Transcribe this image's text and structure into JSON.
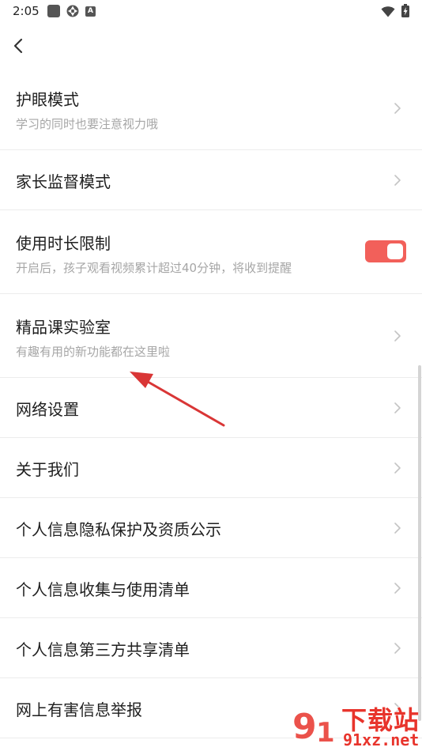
{
  "status_bar": {
    "time": "2:05",
    "icons": [
      "square-notification-icon",
      "aperture-icon",
      "a-notification-icon",
      "wifi-icon",
      "battery-icon"
    ]
  },
  "toolbar": {
    "back_icon": "chevron-left-icon"
  },
  "settings": {
    "eye_protection": {
      "title": "护眼模式",
      "subtitle": "学习的同时也要注意视力哦"
    },
    "parental_mode": {
      "title": "家长监督模式"
    },
    "time_limit": {
      "title": "使用时长限制",
      "subtitle": "开启后，孩子观看视频累计超过40分钟，将收到提醒",
      "enabled": true
    },
    "lab": {
      "title": "精品课实验室",
      "subtitle": "有趣有用的新功能都在这里啦"
    },
    "network": {
      "title": "网络设置"
    },
    "about": {
      "title": "关于我们"
    },
    "privacy": {
      "title": "个人信息隐私保护及资质公示"
    },
    "collection_list": {
      "title": "个人信息收集与使用清单"
    },
    "third_party": {
      "title": "个人信息第三方共享清单"
    },
    "report": {
      "title": "网上有害信息举报"
    }
  },
  "colors": {
    "accent": "#f2605a",
    "annotation": "#d93636",
    "title_text": "#1f1f1f",
    "subtitle_text": "#a6a6a6",
    "divider": "#ececec"
  },
  "watermark": {
    "brand_top": "下载站",
    "brand_bottom": "91xz.net"
  }
}
